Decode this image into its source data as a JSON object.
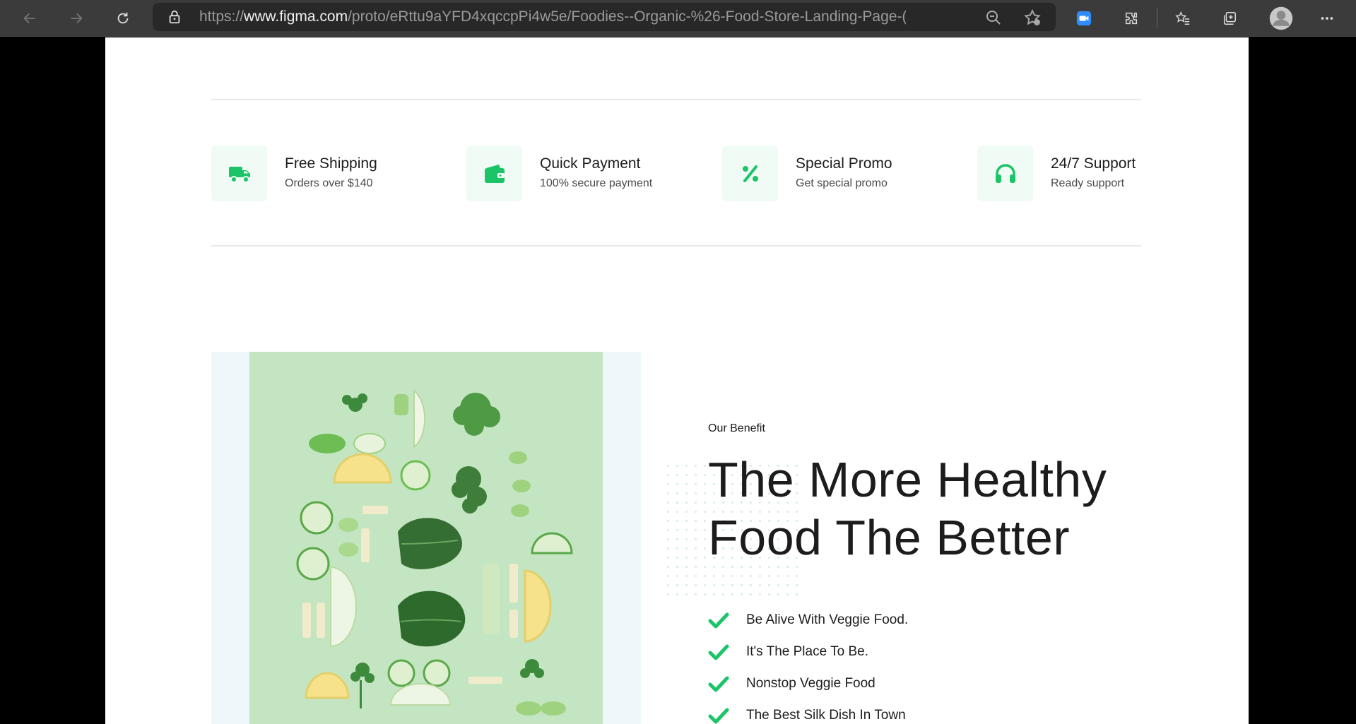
{
  "browser": {
    "url_prefix": "https://",
    "url_domain": "www.figma.com",
    "url_path": "/proto/eRttu9aYFD4xqccpPi4w5e/Foodies--Organic-%26-Food-Store-Landing-Page-(Comm..."
  },
  "features": [
    {
      "title": "Free Shipping",
      "subtitle": "Orders over $140",
      "icon": "truck-icon"
    },
    {
      "title": "Quick Payment",
      "subtitle": "100% secure payment",
      "icon": "wallet-icon"
    },
    {
      "title": "Special Promo",
      "subtitle": "Get special promo",
      "icon": "percent-icon"
    },
    {
      "title": "24/7 Support",
      "subtitle": "Ready support",
      "icon": "headphones-icon"
    }
  ],
  "benefit_section": {
    "eyebrow": "Our Benefit",
    "headline_line1": "The More Healthy",
    "headline_line2": "Food The Better",
    "items": [
      "Be Alive With Veggie Food.",
      "It's The Place To Be.",
      "Nonstop Veggie Food",
      "The Best Silk Dish In Town"
    ]
  },
  "colors": {
    "accent": "#1cc468",
    "icon_bg": "#f1fbf5",
    "text": "#1c1c1c"
  }
}
